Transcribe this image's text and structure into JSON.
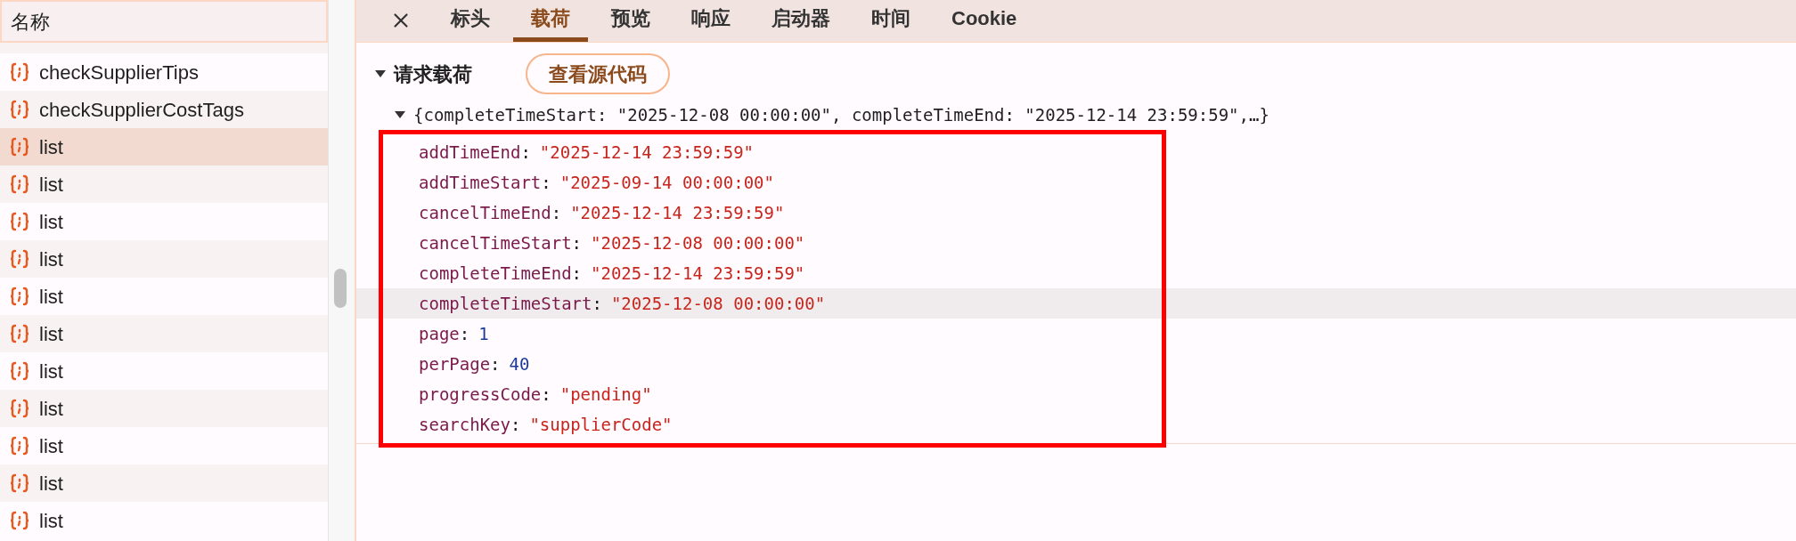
{
  "sidebar": {
    "header": "名称",
    "items": [
      {
        "label": "checkSupplierTips",
        "selected": false
      },
      {
        "label": "checkSupplierCostTags",
        "selected": false
      },
      {
        "label": "list",
        "selected": true
      },
      {
        "label": "list",
        "selected": false
      },
      {
        "label": "list",
        "selected": false
      },
      {
        "label": "list",
        "selected": false
      },
      {
        "label": "list",
        "selected": false
      },
      {
        "label": "list",
        "selected": false
      },
      {
        "label": "list",
        "selected": false
      },
      {
        "label": "list",
        "selected": false
      },
      {
        "label": "list",
        "selected": false
      },
      {
        "label": "list",
        "selected": false
      },
      {
        "label": "list",
        "selected": false
      }
    ]
  },
  "tabs": [
    {
      "label": "标头",
      "selected": false
    },
    {
      "label": "载荷",
      "selected": true
    },
    {
      "label": "预览",
      "selected": false
    },
    {
      "label": "响应",
      "selected": false
    },
    {
      "label": "启动器",
      "selected": false
    },
    {
      "label": "时间",
      "selected": false
    },
    {
      "label": "Cookie",
      "selected": false
    }
  ],
  "payload": {
    "title": "请求载荷",
    "expanded": true,
    "view_source_button": "查看源代码",
    "object": {
      "summary": "{completeTimeStart: \"2025-12-08 00:00:00\", completeTimeEnd: \"2025-12-14 23:59:59\",…}",
      "expanded": true,
      "rows": [
        {
          "key": "addTimeEnd",
          "separator": ":",
          "value": "\"2025-12-14 23:59:59\"",
          "kind": "string",
          "highlighted": false
        },
        {
          "key": "addTimeStart",
          "separator": ":",
          "value": "\"2025-09-14 00:00:00\"",
          "kind": "string",
          "highlighted": false
        },
        {
          "key": "cancelTimeEnd",
          "separator": ":",
          "value": "\"2025-12-14 23:59:59\"",
          "kind": "string",
          "highlighted": false
        },
        {
          "key": "cancelTimeStart",
          "separator": ":",
          "value": "\"2025-12-08 00:00:00\"",
          "kind": "string",
          "highlighted": false
        },
        {
          "key": "completeTimeEnd",
          "separator": ":",
          "value": "\"2025-12-14 23:59:59\"",
          "kind": "string",
          "highlighted": false
        },
        {
          "key": "completeTimeStart",
          "separator": ":",
          "value": "\"2025-12-08 00:00:00\"",
          "kind": "string",
          "highlighted": true
        },
        {
          "key": "page",
          "separator": ":",
          "value": "1",
          "kind": "number",
          "highlighted": false
        },
        {
          "key": "perPage",
          "separator": ":",
          "value": "40",
          "kind": "number",
          "highlighted": false
        },
        {
          "key": "progressCode",
          "separator": ":",
          "value": "\"pending\"",
          "kind": "string",
          "highlighted": false
        },
        {
          "key": "searchKey",
          "separator": ":",
          "value": "\"supplierCode\"",
          "kind": "string",
          "highlighted": false
        }
      ]
    }
  }
}
